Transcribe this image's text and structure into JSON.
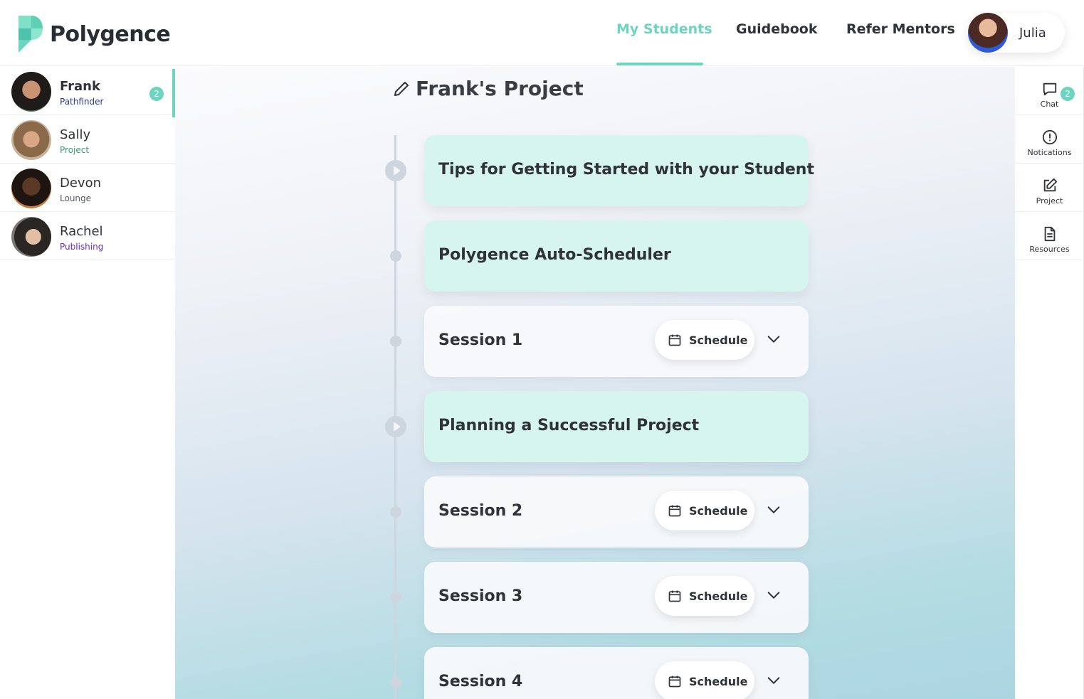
{
  "brand": {
    "name": "Polygence",
    "accent": "#6dd5bf"
  },
  "nav": {
    "items": [
      "My Students",
      "Guidebook",
      "Refer Mentors"
    ],
    "active_index": 0
  },
  "user": {
    "name": "Julia",
    "avatar": "user-avatar"
  },
  "students": [
    {
      "name": "Frank",
      "stage": "Pathfinder",
      "stage_color": "#2b3a9c",
      "badge": "2",
      "active": true
    },
    {
      "name": "Sally",
      "stage": "Project",
      "stage_color": "#3a9a7d",
      "badge": "",
      "active": false
    },
    {
      "name": "Devon",
      "stage": "Lounge",
      "stage_color": "#555a60",
      "badge": "",
      "active": false
    },
    {
      "name": "Rachel",
      "stage": "Publishing",
      "stage_color": "#6a2ab8",
      "badge": "",
      "active": false
    }
  ],
  "project": {
    "title": "Frank's Project",
    "cards": [
      {
        "label": "Tips for Getting Started with your Student",
        "kind": "video"
      },
      {
        "label": "Polygence Auto-Scheduler",
        "kind": "info"
      },
      {
        "label": "Session 1",
        "kind": "session",
        "button": "Schedule"
      },
      {
        "label": "Planning a Successful Project",
        "kind": "video"
      },
      {
        "label": "Session 2",
        "kind": "session",
        "button": "Schedule"
      },
      {
        "label": "Session 3",
        "kind": "session",
        "button": "Schedule"
      },
      {
        "label": "Session 4",
        "kind": "session",
        "button": "Schedule"
      }
    ]
  },
  "rail": {
    "items": [
      {
        "label": "Chat",
        "icon": "chat-icon",
        "badge": "2"
      },
      {
        "label": "Notications",
        "icon": "alert-icon",
        "badge": ""
      },
      {
        "label": "Project",
        "icon": "edit-icon",
        "badge": ""
      },
      {
        "label": "Resources",
        "icon": "document-icon",
        "badge": ""
      }
    ]
  }
}
